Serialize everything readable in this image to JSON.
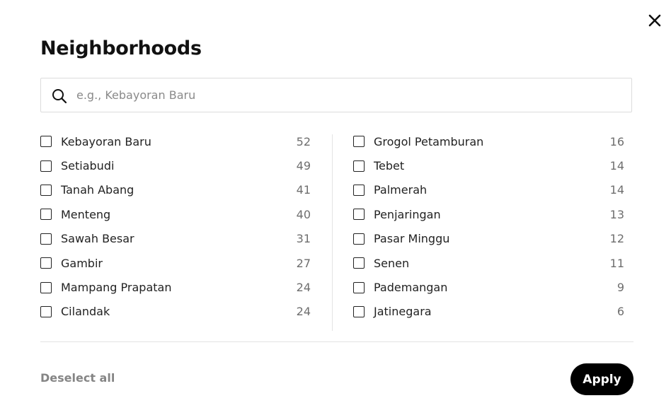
{
  "dialog": {
    "title": "Neighborhoods"
  },
  "search": {
    "placeholder": "e.g., Kebayoran Baru",
    "value": ""
  },
  "neighborhoods_left": [
    {
      "label": "Kebayoran Baru",
      "count": "52",
      "checked": false
    },
    {
      "label": "Setiabudi",
      "count": "49",
      "checked": false
    },
    {
      "label": "Tanah Abang",
      "count": "41",
      "checked": false
    },
    {
      "label": "Menteng",
      "count": "40",
      "checked": false
    },
    {
      "label": "Sawah Besar",
      "count": "31",
      "checked": false
    },
    {
      "label": "Gambir",
      "count": "27",
      "checked": false
    },
    {
      "label": "Mampang Prapatan",
      "count": "24",
      "checked": false
    },
    {
      "label": "Cilandak",
      "count": "24",
      "checked": false
    }
  ],
  "neighborhoods_right": [
    {
      "label": "Grogol Petamburan",
      "count": "16",
      "checked": false
    },
    {
      "label": "Tebet",
      "count": "14",
      "checked": false
    },
    {
      "label": "Palmerah",
      "count": "14",
      "checked": false
    },
    {
      "label": "Penjaringan",
      "count": "13",
      "checked": false
    },
    {
      "label": "Pasar Minggu",
      "count": "12",
      "checked": false
    },
    {
      "label": "Senen",
      "count": "11",
      "checked": false
    },
    {
      "label": "Pademangan",
      "count": "9",
      "checked": false
    },
    {
      "label": "Jatinegara",
      "count": "6",
      "checked": false
    }
  ],
  "footer": {
    "deselect_label": "Deselect all",
    "apply_label": "Apply"
  },
  "icons": {
    "close": "close-icon",
    "search": "search-icon"
  }
}
